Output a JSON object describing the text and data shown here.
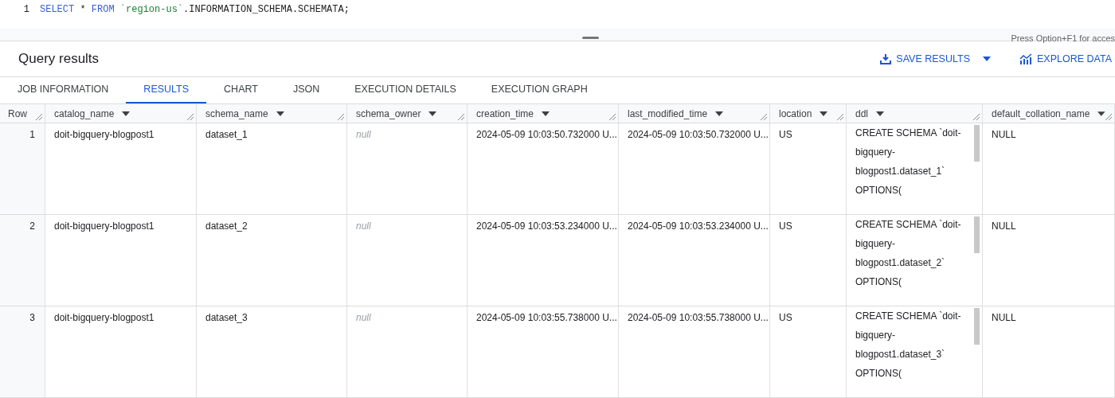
{
  "editor": {
    "line_number": "1",
    "tokens": [
      {
        "kind": "keyword",
        "text": "SELECT"
      },
      {
        "kind": "plain",
        "text": " * "
      },
      {
        "kind": "keyword",
        "text": "FROM"
      },
      {
        "kind": "string",
        "text": " `region-us`"
      },
      {
        "kind": "plain",
        "text": ".INFORMATION_SCHEMA.SCHEMATA;"
      }
    ],
    "hint": "Press Option+F1 for acces"
  },
  "results": {
    "title": "Query results",
    "actions": [
      {
        "kind": "save",
        "label": "SAVE RESULTS",
        "dropdown": true
      },
      {
        "kind": "explore",
        "label": "EXPLORE DATA",
        "dropdown": false
      }
    ]
  },
  "tabs": [
    {
      "label": "JOB INFORMATION",
      "selected": false
    },
    {
      "label": "RESULTS",
      "selected": true
    },
    {
      "label": "CHART",
      "selected": false
    },
    {
      "label": "JSON",
      "selected": false
    },
    {
      "label": "EXECUTION DETAILS",
      "selected": false
    },
    {
      "label": "EXECUTION GRAPH",
      "selected": false
    }
  ],
  "table": {
    "row_header": "Row",
    "columns": [
      "catalog_name",
      "schema_name",
      "schema_owner",
      "creation_time",
      "last_modified_time",
      "location",
      "ddl",
      "default_collation_name"
    ],
    "rows": [
      {
        "row": "1",
        "cells": [
          {
            "kind": "text",
            "text": "doit-bigquery-blogpost1"
          },
          {
            "kind": "text",
            "text": "dataset_1"
          },
          {
            "kind": "null",
            "text": "null"
          },
          {
            "kind": "text",
            "text": "2024-05-09 10:03:50.732000 U..."
          },
          {
            "kind": "text",
            "text": "2024-05-09 10:03:50.732000 U..."
          },
          {
            "kind": "text",
            "text": "US"
          },
          {
            "kind": "ddl",
            "lines": [
              "CREATE SCHEMA `doit-",
              "bigquery-",
              "blogpost1.dataset_1`",
              "OPTIONS("
            ]
          },
          {
            "kind": "text",
            "text": "NULL"
          }
        ]
      },
      {
        "row": "2",
        "cells": [
          {
            "kind": "text",
            "text": "doit-bigquery-blogpost1"
          },
          {
            "kind": "text",
            "text": "dataset_2"
          },
          {
            "kind": "null",
            "text": "null"
          },
          {
            "kind": "text",
            "text": "2024-05-09 10:03:53.234000 U..."
          },
          {
            "kind": "text",
            "text": "2024-05-09 10:03:53.234000 U..."
          },
          {
            "kind": "text",
            "text": "US"
          },
          {
            "kind": "ddl",
            "lines": [
              "CREATE SCHEMA `doit-",
              "bigquery-",
              "blogpost1.dataset_2`",
              "OPTIONS("
            ]
          },
          {
            "kind": "text",
            "text": "NULL"
          }
        ]
      },
      {
        "row": "3",
        "cells": [
          {
            "kind": "text",
            "text": "doit-bigquery-blogpost1"
          },
          {
            "kind": "text",
            "text": "dataset_3"
          },
          {
            "kind": "null",
            "text": "null"
          },
          {
            "kind": "text",
            "text": "2024-05-09 10:03:55.738000 U..."
          },
          {
            "kind": "text",
            "text": "2024-05-09 10:03:55.738000 U..."
          },
          {
            "kind": "text",
            "text": "US"
          },
          {
            "kind": "ddl",
            "lines": [
              "CREATE SCHEMA `doit-",
              "bigquery-",
              "blogpost1.dataset_3`",
              "OPTIONS("
            ]
          },
          {
            "kind": "text",
            "text": "NULL"
          }
        ]
      }
    ]
  }
}
